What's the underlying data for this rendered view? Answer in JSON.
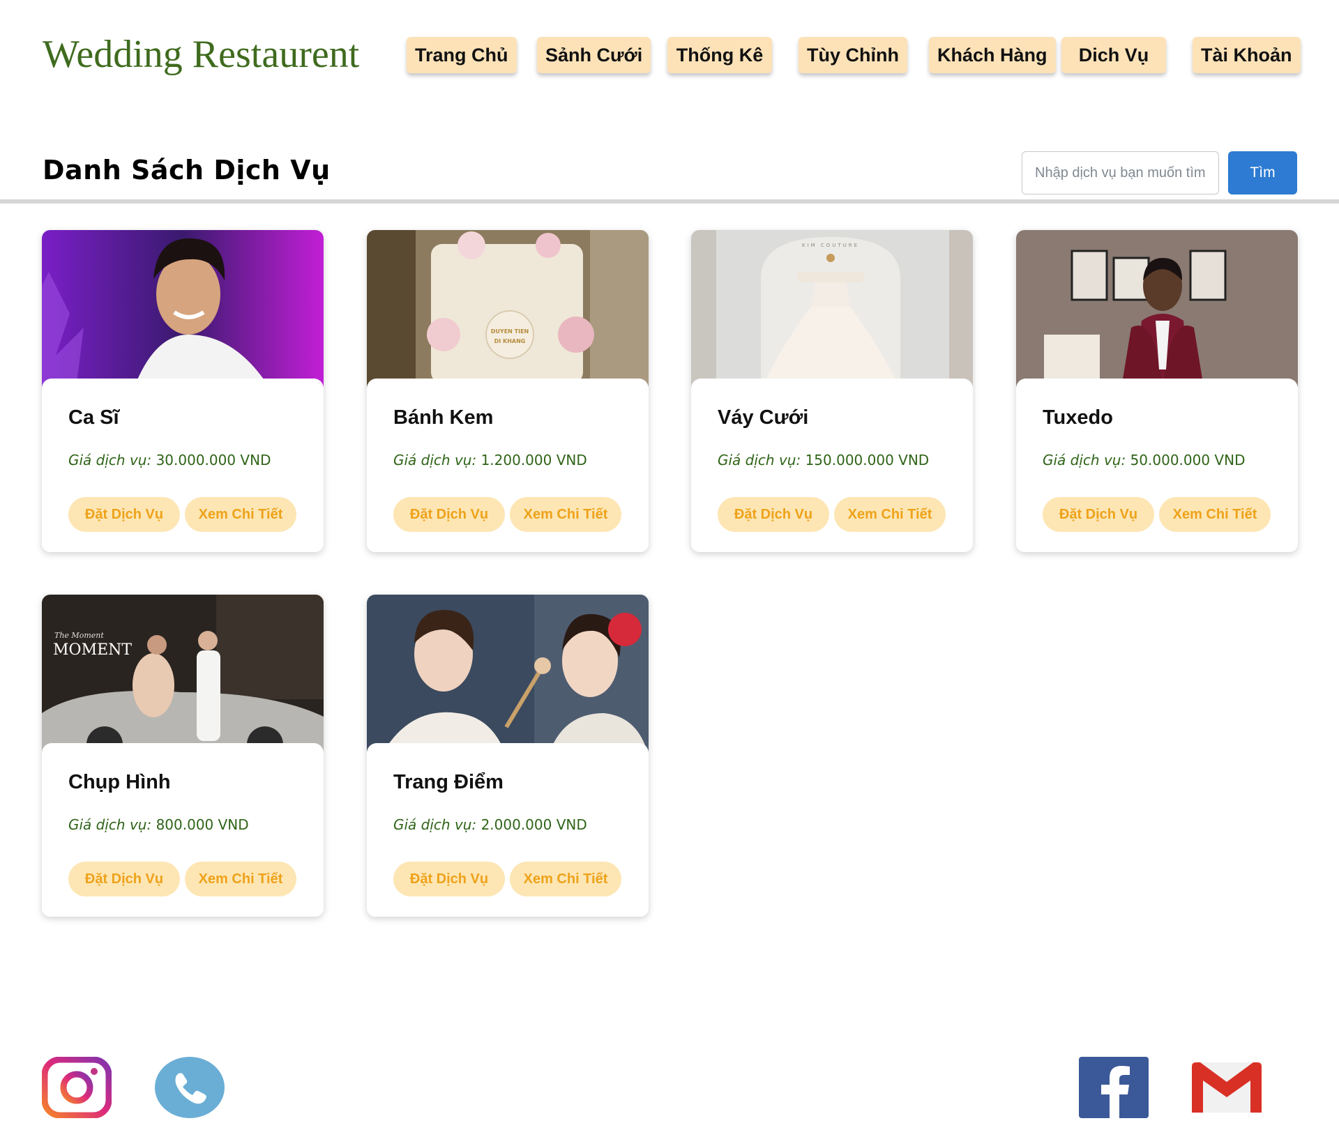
{
  "header": {
    "brand": "Wedding Restaurent",
    "nav": [
      {
        "label": "Trang Chủ"
      },
      {
        "label": "Sảnh Cưới"
      },
      {
        "label": "Thống Kê"
      },
      {
        "label": "Tùy Chỉnh"
      },
      {
        "label": "Khách Hàng"
      },
      {
        "label": "Dich Vụ"
      },
      {
        "label": "Tài Khoản"
      }
    ]
  },
  "main": {
    "title": "Danh Sách Dịch Vụ",
    "search": {
      "placeholder": "Nhập dịch vụ bạn muốn tìm",
      "value": "",
      "button_label": "Tìm"
    },
    "price_label": "Giá dịch vụ:",
    "order_label": "Đặt Dịch Vụ",
    "detail_label": "Xem Chi Tiết",
    "services": [
      {
        "name": "Ca Sĩ",
        "price": "30.000.000 VND"
      },
      {
        "name": "Bánh Kem",
        "price": "1.200.000 VND"
      },
      {
        "name": "Váy Cưới",
        "price": "150.000.000 VND"
      },
      {
        "name": "Tuxedo",
        "price": "50.000.000 VND"
      },
      {
        "name": "Chụp Hình",
        "price": "800.000 VND"
      },
      {
        "name": "Trang Điểm",
        "price": "2.000.000 VND"
      }
    ]
  },
  "image_text": {
    "cake_text_1": "DUYEN TIEN",
    "cake_text_2": "DI KHANG",
    "dress_text": "KIM COUTURE",
    "photo_text_1": "The Moment",
    "photo_text_2": "MOMENT"
  },
  "footer": {
    "icons": [
      "instagram-icon",
      "phone-icon",
      "facebook-icon",
      "gmail-icon"
    ]
  },
  "colors": {
    "brand": "#3f6b1e",
    "nav_bg": "#fde2b8",
    "button_bg": "#fde6b4",
    "button_text": "#eea21a",
    "search_button": "#2d7bd2",
    "price_text": "#2f6418"
  }
}
